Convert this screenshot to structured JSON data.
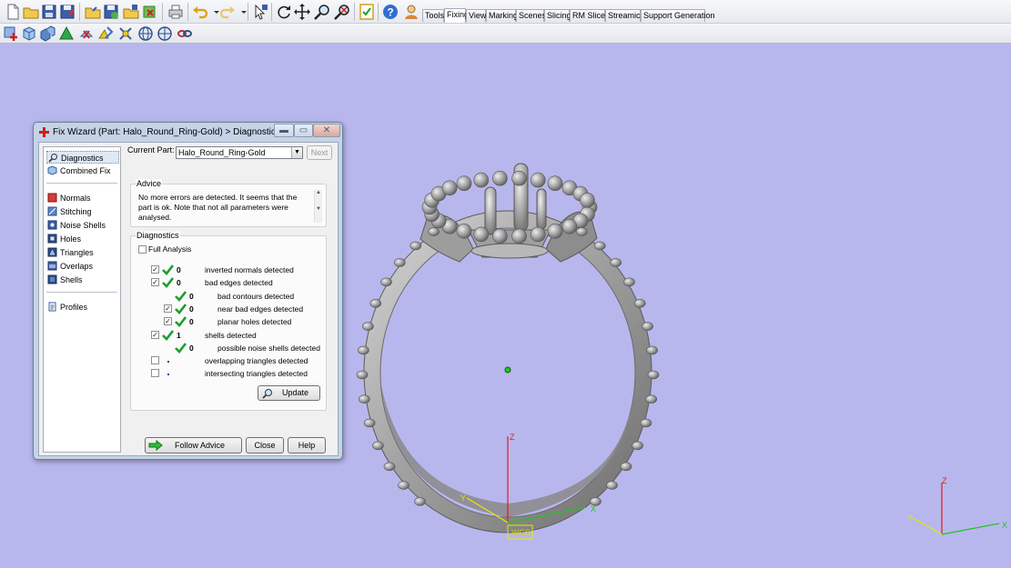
{
  "menu_tabs": [
    {
      "label": "Tools",
      "active": false
    },
    {
      "label": "Fixing",
      "active": true
    },
    {
      "label": "View",
      "active": false
    },
    {
      "label": "Marking",
      "active": false
    },
    {
      "label": "Scenes",
      "active": false
    },
    {
      "label": "Slicing",
      "active": false
    },
    {
      "label": "RM Slicer",
      "active": false
    },
    {
      "label": "Streamics",
      "active": false
    },
    {
      "label": "Support Generation",
      "active": false
    }
  ],
  "dialog": {
    "title": "Fix Wizard (Part: Halo_Round_Ring-Gold) > Diagnostics",
    "nav": {
      "top": [
        "Diagnostics",
        "Combined Fix"
      ],
      "tools": [
        "Normals",
        "Stitching",
        "Noise Shells",
        "Holes",
        "Triangles",
        "Overlaps",
        "Shells"
      ],
      "bottom": [
        "Profiles"
      ],
      "selected": "Diagnostics"
    },
    "current_part_label": "Current Part:",
    "current_part_value": "Halo_Round_Ring-Gold",
    "next_label": "Next",
    "advice": {
      "group_label": "Advice",
      "text": "No more errors are detected. It seems that the part is ok. Note that not all parameters were analysed."
    },
    "diagnostics": {
      "group_label": "Diagnostics",
      "full_analysis_label": "Full Analysis",
      "full_analysis_checked": false,
      "rows": [
        {
          "label": "inverted normals detected",
          "count": "0",
          "checked": true,
          "status": "ok",
          "indent": false
        },
        {
          "label": "bad edges detected",
          "count": "0",
          "checked": true,
          "status": "ok",
          "indent": false
        },
        {
          "label": "bad contours detected",
          "count": "0",
          "checked": null,
          "status": "ok",
          "indent": true
        },
        {
          "label": "near bad edges detected",
          "count": "0",
          "checked": true,
          "status": "ok",
          "indent": true
        },
        {
          "label": "planar holes detected",
          "count": "0",
          "checked": true,
          "status": "ok",
          "indent": true
        },
        {
          "label": "shells detected",
          "count": "1",
          "checked": true,
          "status": "ok",
          "indent": false
        },
        {
          "label": "possible noise shells detected",
          "count": "0",
          "checked": null,
          "status": "ok",
          "indent": true
        },
        {
          "label": "overlapping triangles detected",
          "count": "",
          "checked": false,
          "status": "none",
          "indent": false
        },
        {
          "label": "intersecting triangles detected",
          "count": "",
          "checked": false,
          "status": "none",
          "indent": false
        }
      ],
      "update_label": "Update"
    },
    "buttons": {
      "follow_advice": "Follow Advice",
      "close": "Close",
      "help": "Help"
    }
  },
  "viewport": {
    "axis_labels": {
      "z": "Z",
      "y": "Y",
      "x": "X"
    },
    "wcs_label": "WCS",
    "colors": {
      "background": "#b8b7ed",
      "model": "#9a9a9a",
      "x_axis": "#22c422",
      "y_axis": "#e6e600",
      "z_axis": "#e01e1e"
    }
  }
}
